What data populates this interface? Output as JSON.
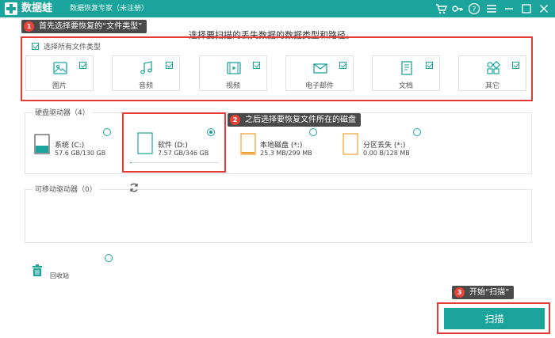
{
  "titlebar": {
    "app_name": "数据蛙",
    "app_subtitle": "数据恢复专家（未注册）",
    "accent": "#1ba49b"
  },
  "instruction": "选择要扫描的丢失数据的数据类型和路径。",
  "callouts": [
    {
      "num": "1",
      "text": "首先选择要恢复的“文件类型”"
    },
    {
      "num": "2",
      "text": "之后选择要恢复文件所在的磁盘"
    },
    {
      "num": "3",
      "text": "开始“扫描”"
    }
  ],
  "file_types": {
    "select_all_label": "选择所有文件类型",
    "select_all_checked": true,
    "items": [
      {
        "label": "图片",
        "icon": "image-icon",
        "checked": true
      },
      {
        "label": "音频",
        "icon": "music-icon",
        "checked": true
      },
      {
        "label": "视频",
        "icon": "video-icon",
        "checked": true
      },
      {
        "label": "电子邮件",
        "icon": "mail-icon",
        "checked": true
      },
      {
        "label": "文档",
        "icon": "document-icon",
        "checked": true
      },
      {
        "label": "其它",
        "icon": "other-icon",
        "checked": true
      }
    ]
  },
  "hard_drives": {
    "title": "硬盘驱动器（4）",
    "drives": [
      {
        "name": "系统 (C:)",
        "size": "57.6 GB/130 GB",
        "selected": false,
        "usage": 0.44
      },
      {
        "name": "软件 (D:)",
        "size": "7.57 GB/346 GB",
        "selected": true,
        "usage": 0.02
      },
      {
        "name": "本地磁盘 (*:)",
        "size": "25.3 MB/299 MB",
        "selected": false,
        "usage": 0.08
      },
      {
        "name": "分区丢失 (*:)",
        "size": "0.00  B/128 MB",
        "selected": false,
        "usage": 0
      }
    ]
  },
  "removable": {
    "title": "可移动驱动器（0）"
  },
  "recycle_bin": {
    "label": "回收站"
  },
  "scan_button": "扫描"
}
